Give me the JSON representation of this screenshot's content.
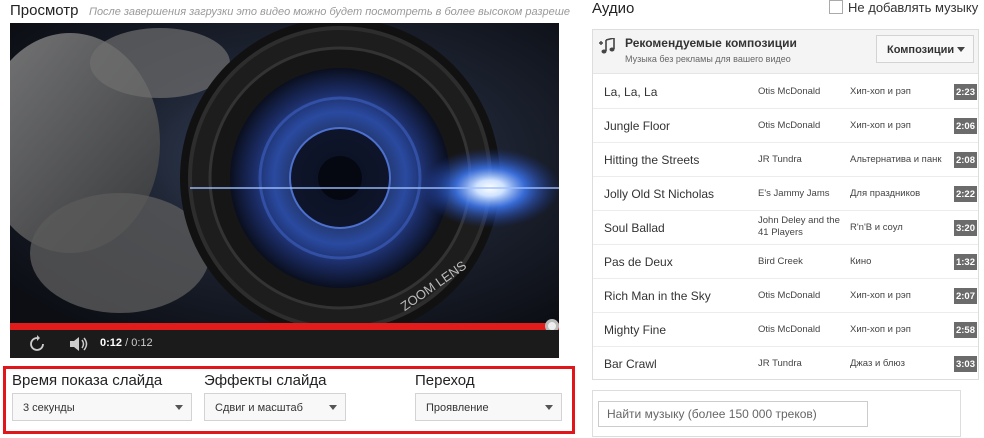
{
  "preview": {
    "title": "Просмотр",
    "note": "После завершения загрузки это видео можно будет посмотреть в более высоком разрешении.",
    "lens_text": "ZOOM LENS",
    "current_time": "0:12",
    "total_time": " / 0:12",
    "progress_fraction": 1.0
  },
  "settings": {
    "duration_label": "Время показа слайда",
    "duration_value": "3 секунды",
    "effects_label": "Эффекты слайда",
    "effects_value": "Сдвиг и масштаб",
    "transition_label": "Переход",
    "transition_value": "Проявление"
  },
  "audio": {
    "title": "Аудио",
    "no_music_label": "Не добавлять музыку",
    "no_music_checked": false,
    "playlist_title": "Рекомендуемые композиции",
    "playlist_subtitle": "Музыка без рекламы для вашего видео",
    "dropdown_label": "Композиции",
    "tracks": [
      {
        "name": "La, La, La",
        "artist": "Otis McDonald",
        "genre": "Хип-хоп и рэп",
        "duration": "2:23"
      },
      {
        "name": "Jungle Floor",
        "artist": "Otis McDonald",
        "genre": "Хип-хоп и рэп",
        "duration": "2:06"
      },
      {
        "name": "Hitting the Streets",
        "artist": "JR Tundra",
        "genre": "Альтернатива и панк",
        "duration": "2:08"
      },
      {
        "name": "Jolly Old St Nicholas",
        "artist": "E's Jammy Jams",
        "genre": "Для праздников",
        "duration": "2:22"
      },
      {
        "name": "Soul Ballad",
        "artist": "John Deley and the 41 Players",
        "genre": "R'n'B и соул",
        "duration": "3:20"
      },
      {
        "name": "Pas de Deux",
        "artist": "Bird Creek",
        "genre": "Кино",
        "duration": "1:32"
      },
      {
        "name": "Rich Man in the Sky",
        "artist": "Otis McDonald",
        "genre": "Хип-хоп и рэп",
        "duration": "2:07"
      },
      {
        "name": "Mighty Fine",
        "artist": "Otis McDonald",
        "genre": "Хип-хоп и рэп",
        "duration": "2:58"
      },
      {
        "name": "Bar Crawl",
        "artist": "JR Tundra",
        "genre": "Джаз и блюз",
        "duration": "3:03"
      }
    ],
    "search_placeholder": "Найти музыку (более 150 000 треков)"
  },
  "colors": {
    "progress": "#e21b1b",
    "highlight_border": "#e0161b",
    "duration_badge": "#6b6b6b"
  },
  "icons": {
    "replay": "replay-icon",
    "volume": "volume-icon",
    "music_note": "music-note-add-icon",
    "caret": "caret-down-icon"
  }
}
